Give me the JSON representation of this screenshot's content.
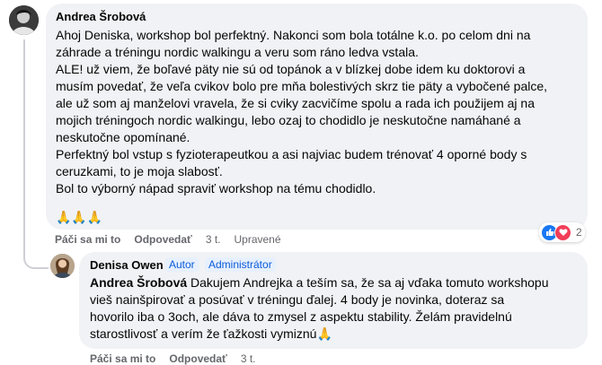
{
  "comment1": {
    "author": "Andrea Šrobová",
    "lines": [
      "Ahoj Deniska, workshop bol perfektný. Nakonci som bola totálne k.o. po celom dni na",
      "záhrade a tréningu nordic walkingu a veru som ráno ledva vstala.",
      "ALE! už viem, že boľavé päty nie sú od topánok a v blízkej dobe idem ku doktorovi a",
      "musím povedať, že veľa cvikov bolo pre mňa bolestivých skrz tie päty a vybočené palce,",
      "ale už som aj manželovi vravela, že si cviky zacvičíme spolu a rada ich použijem aj na",
      "mojich tréningoch nordic walkingu, lebo ozaj to chodidlo je neskutočne namáhané a",
      "neskutočne opomínané.",
      "Perfektný bol vstup s fyzioterapeutkou a asi najviac budem trénovať 4 oporné body s",
      "ceruzkami, to je moja slabosť.",
      "Bol to výborný nápad spraviť workshop na tému chodidlo."
    ],
    "emoji": "🙏🙏🙏",
    "actions": {
      "like": "Páči sa mi to",
      "reply": "Odpovedať",
      "time": "3 t.",
      "edited": "Upravené"
    },
    "reactions": {
      "count": "2",
      "icons": [
        "like-icon",
        "love-icon"
      ]
    }
  },
  "comment2": {
    "author": "Denisa Owen",
    "badges": [
      "Autor",
      "Administrátor"
    ],
    "mention": "Andrea Šrobová",
    "lines": [
      " Dakujem Andrejka a teším sa, že sa aj vďaka tomuto workshopu",
      "vieš nainšpirovať a posúvať v tréningu ďalej. 4 body je novinka, doteraz sa",
      "hovorilo iba o 3och, ale dáva to zmysel z aspektu stability. Želám pravidelnú",
      "starostlivosť a verím že ťažkosti vymiznú🙏"
    ],
    "actions": {
      "like": "Páči sa mi to",
      "reply": "Odpovedať",
      "time": "3 t."
    }
  },
  "colors": {
    "bubble": "#f0f2f5",
    "secondary_text": "#65676b",
    "badge_text": "#0a5bd8",
    "like": "#1877f2",
    "love": "#f33e58"
  }
}
